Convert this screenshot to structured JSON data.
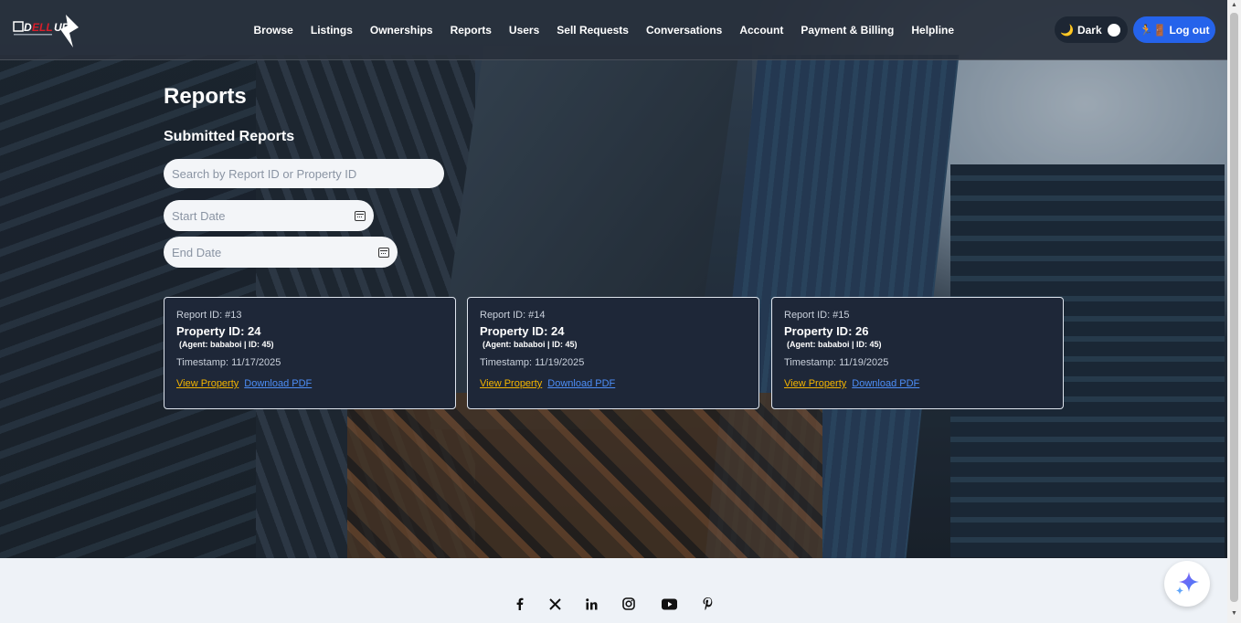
{
  "nav": {
    "items": [
      "Browse",
      "Listings",
      "Ownerships",
      "Reports",
      "Users",
      "Sell Requests",
      "Conversations",
      "Account",
      "Payment & Billing",
      "Helpline"
    ]
  },
  "theme": {
    "label": "Dark",
    "icon": "moon-icon"
  },
  "logout": {
    "label": "Log out",
    "icon": "exit-icon"
  },
  "page": {
    "title": "Reports",
    "section_title": "Submitted Reports"
  },
  "filters": {
    "search_placeholder": "Search by Report ID or Property ID",
    "start_placeholder": "Start Date",
    "end_placeholder": "End Date"
  },
  "reports": [
    {
      "report_id": "Report ID: #13",
      "property": "Property ID: 24",
      "agent": "(Agent: bababoi | ID: 45)",
      "timestamp": "Timestamp: 11/17/2025",
      "view": "View Property",
      "pdf": "Download PDF"
    },
    {
      "report_id": "Report ID: #14",
      "property": "Property ID: 24",
      "agent": "(Agent: bababoi | ID: 45)",
      "timestamp": "Timestamp: 11/19/2025",
      "view": "View Property",
      "pdf": "Download PDF"
    },
    {
      "report_id": "Report ID: #15",
      "property": "Property ID: 26",
      "agent": "(Agent: bababoi | ID: 45)",
      "timestamp": "Timestamp: 11/19/2025",
      "view": "View Property",
      "pdf": "Download PDF"
    }
  ],
  "footer": {
    "social": [
      "facebook-icon",
      "x-icon",
      "linkedin-icon",
      "instagram-icon",
      "youtube-icon",
      "pinterest-icon"
    ]
  },
  "colors": {
    "accent": "#2563eb",
    "view_link": "#f4b400",
    "pdf_link": "#4d8ef7",
    "card_bg": "#1e2738"
  }
}
